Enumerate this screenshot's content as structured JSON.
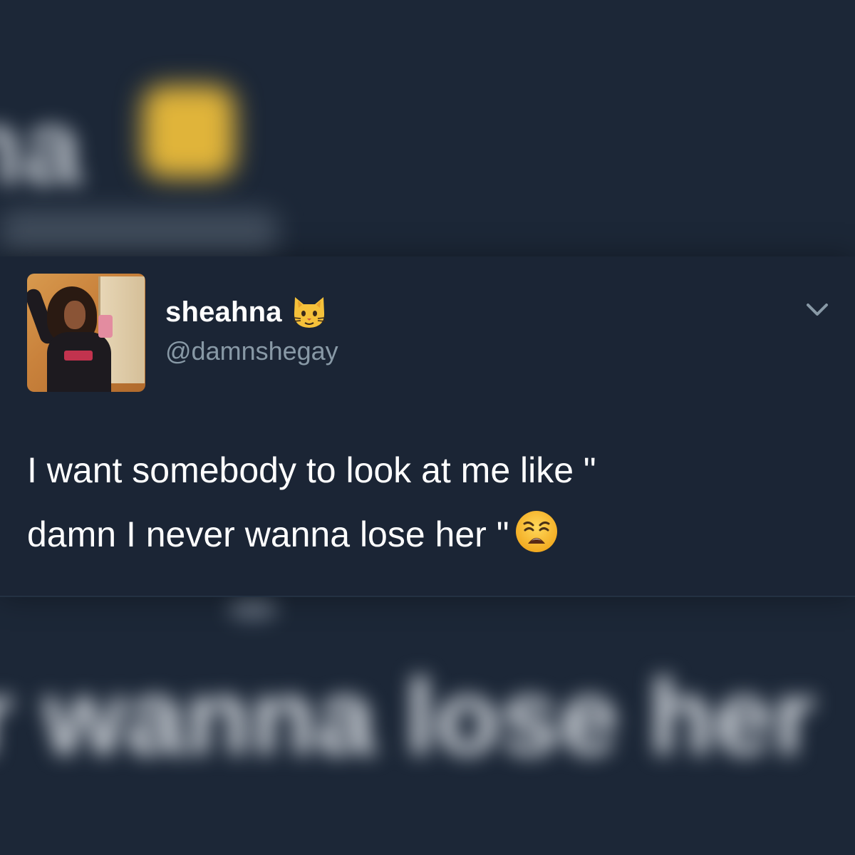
{
  "tweet": {
    "display_name": "sheahna",
    "handle": "@damnshegay",
    "name_emoji_icon": "cat-face-icon",
    "text_line_1": "I want somebody to look at me like \"",
    "text_line_2": "damn I never wanna lose her \"",
    "text_emoji_icon": "weary-face-icon",
    "menu_icon": "chevron-down-icon"
  },
  "background": {
    "blurred_bottom_text": "r wanna lose her"
  },
  "colors": {
    "background": "#1b2636",
    "card": "#1b2535",
    "text_primary": "#ffffff",
    "text_secondary": "#8899a6",
    "emoji_yellow": "#f5c13a"
  }
}
